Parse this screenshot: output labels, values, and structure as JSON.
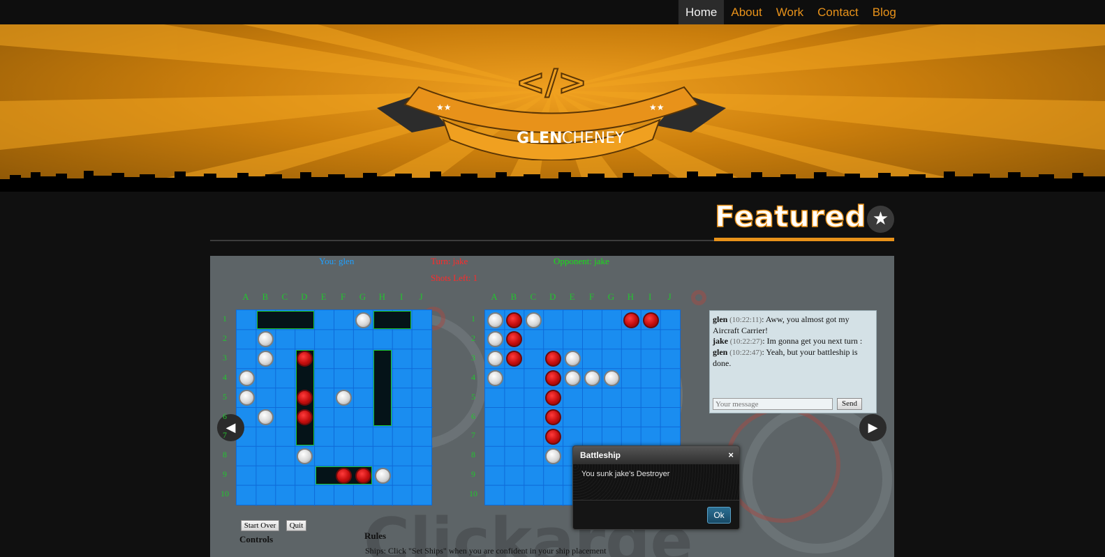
{
  "nav": {
    "items": [
      {
        "label": "Home",
        "active": true
      },
      {
        "label": "About"
      },
      {
        "label": "Work"
      },
      {
        "label": "Contact"
      },
      {
        "label": "Blog"
      }
    ]
  },
  "logo": {
    "symbol": "</>",
    "first": "GLEN",
    "last": "CHENEY"
  },
  "section": {
    "title": "Featured",
    "icon": "star-icon"
  },
  "game": {
    "you_label": "You: glen",
    "turn_label": "Turn: jake",
    "opponent_label": "Opponent: jake",
    "shots_left": "Shots Left: 1",
    "columns": [
      "A",
      "B",
      "C",
      "D",
      "E",
      "F",
      "G",
      "H",
      "I",
      "J"
    ],
    "rows": [
      "1",
      "2",
      "3",
      "4",
      "5",
      "6",
      "7",
      "8",
      "9",
      "10"
    ],
    "your_board": {
      "ships": [
        {
          "col": 1,
          "row": 0,
          "w": 3,
          "h": 1
        },
        {
          "col": 7,
          "row": 0,
          "w": 2,
          "h": 1
        },
        {
          "col": 3,
          "row": 2,
          "w": 1,
          "h": 5
        },
        {
          "col": 7,
          "row": 2,
          "w": 1,
          "h": 4
        },
        {
          "col": 4,
          "row": 8,
          "w": 3,
          "h": 1
        }
      ],
      "hits": [
        [
          3,
          2
        ],
        [
          3,
          4
        ],
        [
          3,
          5
        ],
        [
          5,
          8
        ],
        [
          6,
          8
        ]
      ],
      "misses": [
        [
          6,
          0
        ],
        [
          1,
          1
        ],
        [
          1,
          2
        ],
        [
          0,
          3
        ],
        [
          0,
          4
        ],
        [
          5,
          4
        ],
        [
          1,
          5
        ],
        [
          3,
          7
        ],
        [
          7,
          8
        ]
      ]
    },
    "opponent_board": {
      "hits": [
        [
          1,
          0
        ],
        [
          7,
          0
        ],
        [
          8,
          0
        ],
        [
          1,
          1
        ],
        [
          1,
          2
        ],
        [
          3,
          2
        ],
        [
          3,
          3
        ],
        [
          3,
          4
        ],
        [
          3,
          5
        ],
        [
          3,
          6
        ]
      ],
      "misses": [
        [
          0,
          0
        ],
        [
          2,
          0
        ],
        [
          0,
          1
        ],
        [
          0,
          2
        ],
        [
          4,
          2
        ],
        [
          0,
          3
        ],
        [
          4,
          3
        ],
        [
          5,
          3
        ],
        [
          6,
          3
        ],
        [
          3,
          7
        ]
      ]
    },
    "colors": {
      "you": "#1fa0ff",
      "turn": "#ff2a2a",
      "opponent": "#18e018",
      "grid": "#1a8df0"
    }
  },
  "chat": {
    "messages": [
      {
        "name": "glen",
        "time": "(10:22:11)",
        "text": ": Aww, you almost got my Aircraft Carrier!"
      },
      {
        "name": "jake",
        "time": "(10:22:27)",
        "text": ": Im gonna get you next turn :"
      },
      {
        "name": "glen",
        "time": "(10:22:47)",
        "text": ": Yeah, but your battleship is done."
      }
    ],
    "placeholder": "Your message",
    "send_label": "Send"
  },
  "dialog": {
    "title": "Battleship",
    "message": "You sunk jake's Destroyer",
    "ok_label": "Ok",
    "close_glyph": "×"
  },
  "controls": {
    "start_over": "Start Over",
    "quit": "Quit",
    "controls_heading": "Controls",
    "rules_heading": "Rules",
    "rules_line": "Ships: Click \"Set Ships\" when you are confident in your ship placement"
  }
}
